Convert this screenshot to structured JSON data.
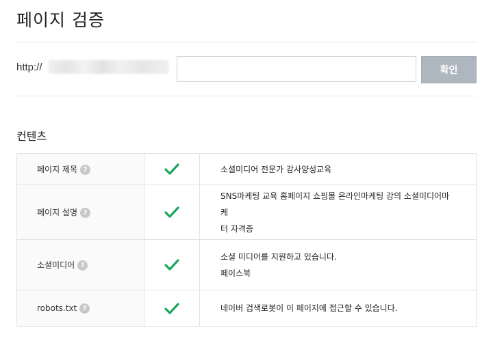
{
  "page": {
    "title": "페이지 검증"
  },
  "url_form": {
    "prefix": "http://",
    "input_value": "",
    "placeholder": "",
    "confirm_label": "확인"
  },
  "section": {
    "heading": "컨텐츠"
  },
  "rows": [
    {
      "label": "페이지 제목",
      "status": "pass",
      "lines": [
        "소셜미디어 전문가 강사양성교육"
      ]
    },
    {
      "label": "페이지 설명",
      "status": "pass",
      "lines": [
        "SNS마케팅 교육 홈페이지 쇼핑몰 온라인마케팅 강의 소셜미디어마케",
        "터 자격증"
      ]
    },
    {
      "label": "소셜미디어",
      "status": "pass",
      "lines": [
        "소셜 미디어를 지원하고 있습니다.",
        "페이스북"
      ]
    },
    {
      "label": "robots.txt",
      "status": "pass",
      "lines": [
        "네이버 검색로봇이 이 페이지에 접근할 수 있습니다."
      ]
    }
  ],
  "icons": {
    "help": "question-circle-icon",
    "status_pass": "checkmark-icon"
  },
  "colors": {
    "check": "#1aa55a",
    "button_bg": "#aeb7bf",
    "help_icon": "#c8c8c8"
  }
}
